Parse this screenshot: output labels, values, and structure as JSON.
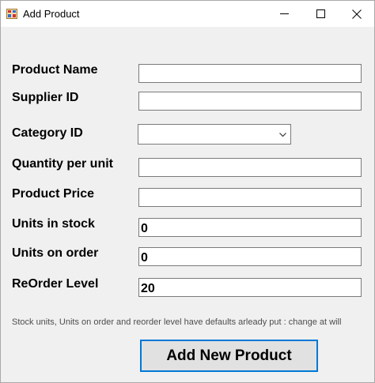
{
  "window": {
    "title": "Add Product",
    "icon": "app-form-icon",
    "controls": [
      "minimize-icon",
      "maximize-icon",
      "close-icon"
    ]
  },
  "form": {
    "product_name": {
      "label": "Product Name",
      "value": ""
    },
    "supplier_id": {
      "label": "Supplier ID",
      "value": ""
    },
    "category_id": {
      "label": "Category ID",
      "value": ""
    },
    "quantity_per_unit": {
      "label": "Quantity per unit",
      "value": ""
    },
    "product_price": {
      "label": "Product Price",
      "value": ""
    },
    "units_in_stock": {
      "label": "Units in stock",
      "value": "0"
    },
    "units_on_order": {
      "label": "Units on order",
      "value": "0"
    },
    "reorder_level": {
      "label": "ReOrder Level",
      "value": "20"
    }
  },
  "hint": "Stock units, Units  on order and reorder level have defaults arleady put : change at will",
  "submit_label": "Add New Product",
  "colors": {
    "window_bg": "#f0f0f0",
    "titlebar_bg": "#ffffff",
    "field_border": "#7a7a7a",
    "button_bg": "#e1e1e1",
    "button_border": "#0078d7"
  }
}
